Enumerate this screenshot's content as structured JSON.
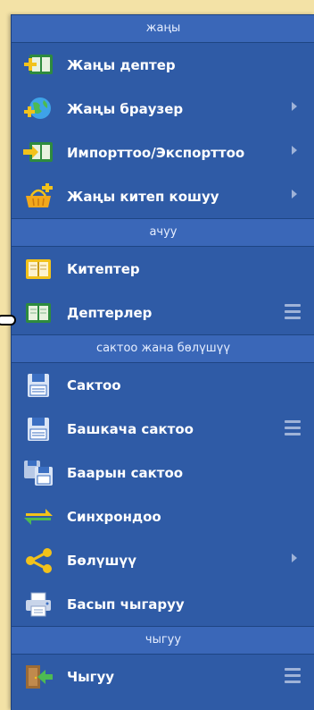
{
  "sections": [
    {
      "header": "жаңы",
      "items": [
        {
          "label": "Жаңы дептер",
          "icon": "new-notebook-icon",
          "right": "none"
        },
        {
          "label": "Жаңы браузер",
          "icon": "new-browser-globe-icon",
          "right": "arrow"
        },
        {
          "label": "Импорттоо/Экспорттоо",
          "icon": "import-export-icon",
          "right": "arrow"
        },
        {
          "label": "Жаңы китеп кошуу",
          "icon": "add-book-basket-icon",
          "right": "arrow"
        }
      ]
    },
    {
      "header": "ачуу",
      "items": [
        {
          "label": "Китептер",
          "icon": "books-icon",
          "right": "none"
        },
        {
          "label": "Дептерлер",
          "icon": "notebooks-icon",
          "right": "menu"
        }
      ]
    },
    {
      "header": "сактоо жана бөлүшүү",
      "items": [
        {
          "label": "Сактоо",
          "icon": "save-icon",
          "right": "none"
        },
        {
          "label": "Башкача сактоо",
          "icon": "save-as-icon",
          "right": "menu"
        },
        {
          "label": "Баарын сактоо",
          "icon": "save-all-icon",
          "right": "none"
        },
        {
          "label": "Синхрондоо",
          "icon": "sync-icon",
          "right": "none"
        },
        {
          "label": "Бөлүшүү",
          "icon": "share-icon",
          "right": "arrow"
        },
        {
          "label": "Басып чыгаруу",
          "icon": "print-icon",
          "right": "none"
        }
      ]
    },
    {
      "header": "чыгуу",
      "items": [
        {
          "label": "Чыгуу",
          "icon": "exit-door-icon",
          "right": "menu"
        }
      ]
    }
  ]
}
